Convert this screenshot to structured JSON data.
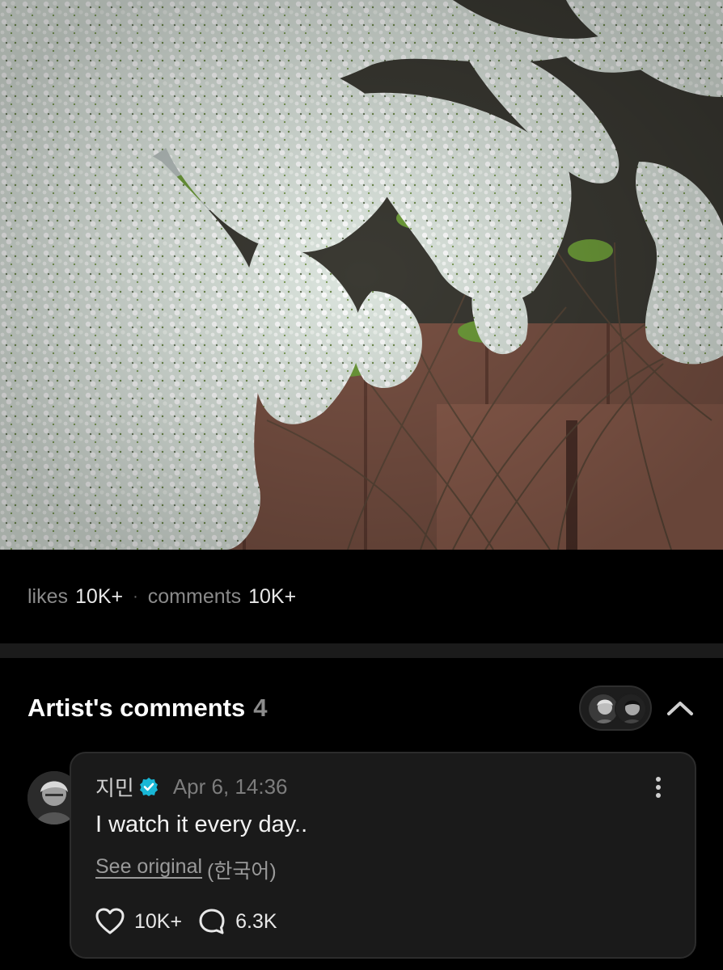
{
  "stats": {
    "likes_label": "likes",
    "likes_value": "10K+",
    "separator": "·",
    "comments_label": "comments",
    "comments_value": "10K+"
  },
  "artist_comments": {
    "title": "Artist's comments",
    "count": "4",
    "comment": {
      "author": "지민",
      "timestamp": "Apr 6, 14:36",
      "text": "I watch it every day..",
      "see_original": "See original",
      "language": "(한국어)",
      "like_count": "10K+",
      "reply_count": "6.3K"
    }
  },
  "colors": {
    "background": "#000000",
    "card": "#1a1a1a",
    "verified": "#19b7d6",
    "muted": "#8a8a8a"
  },
  "icons": [
    "verified-badge-icon",
    "more-vertical-icon",
    "chevron-up-icon",
    "heart-icon",
    "comment-bubble-icon"
  ]
}
